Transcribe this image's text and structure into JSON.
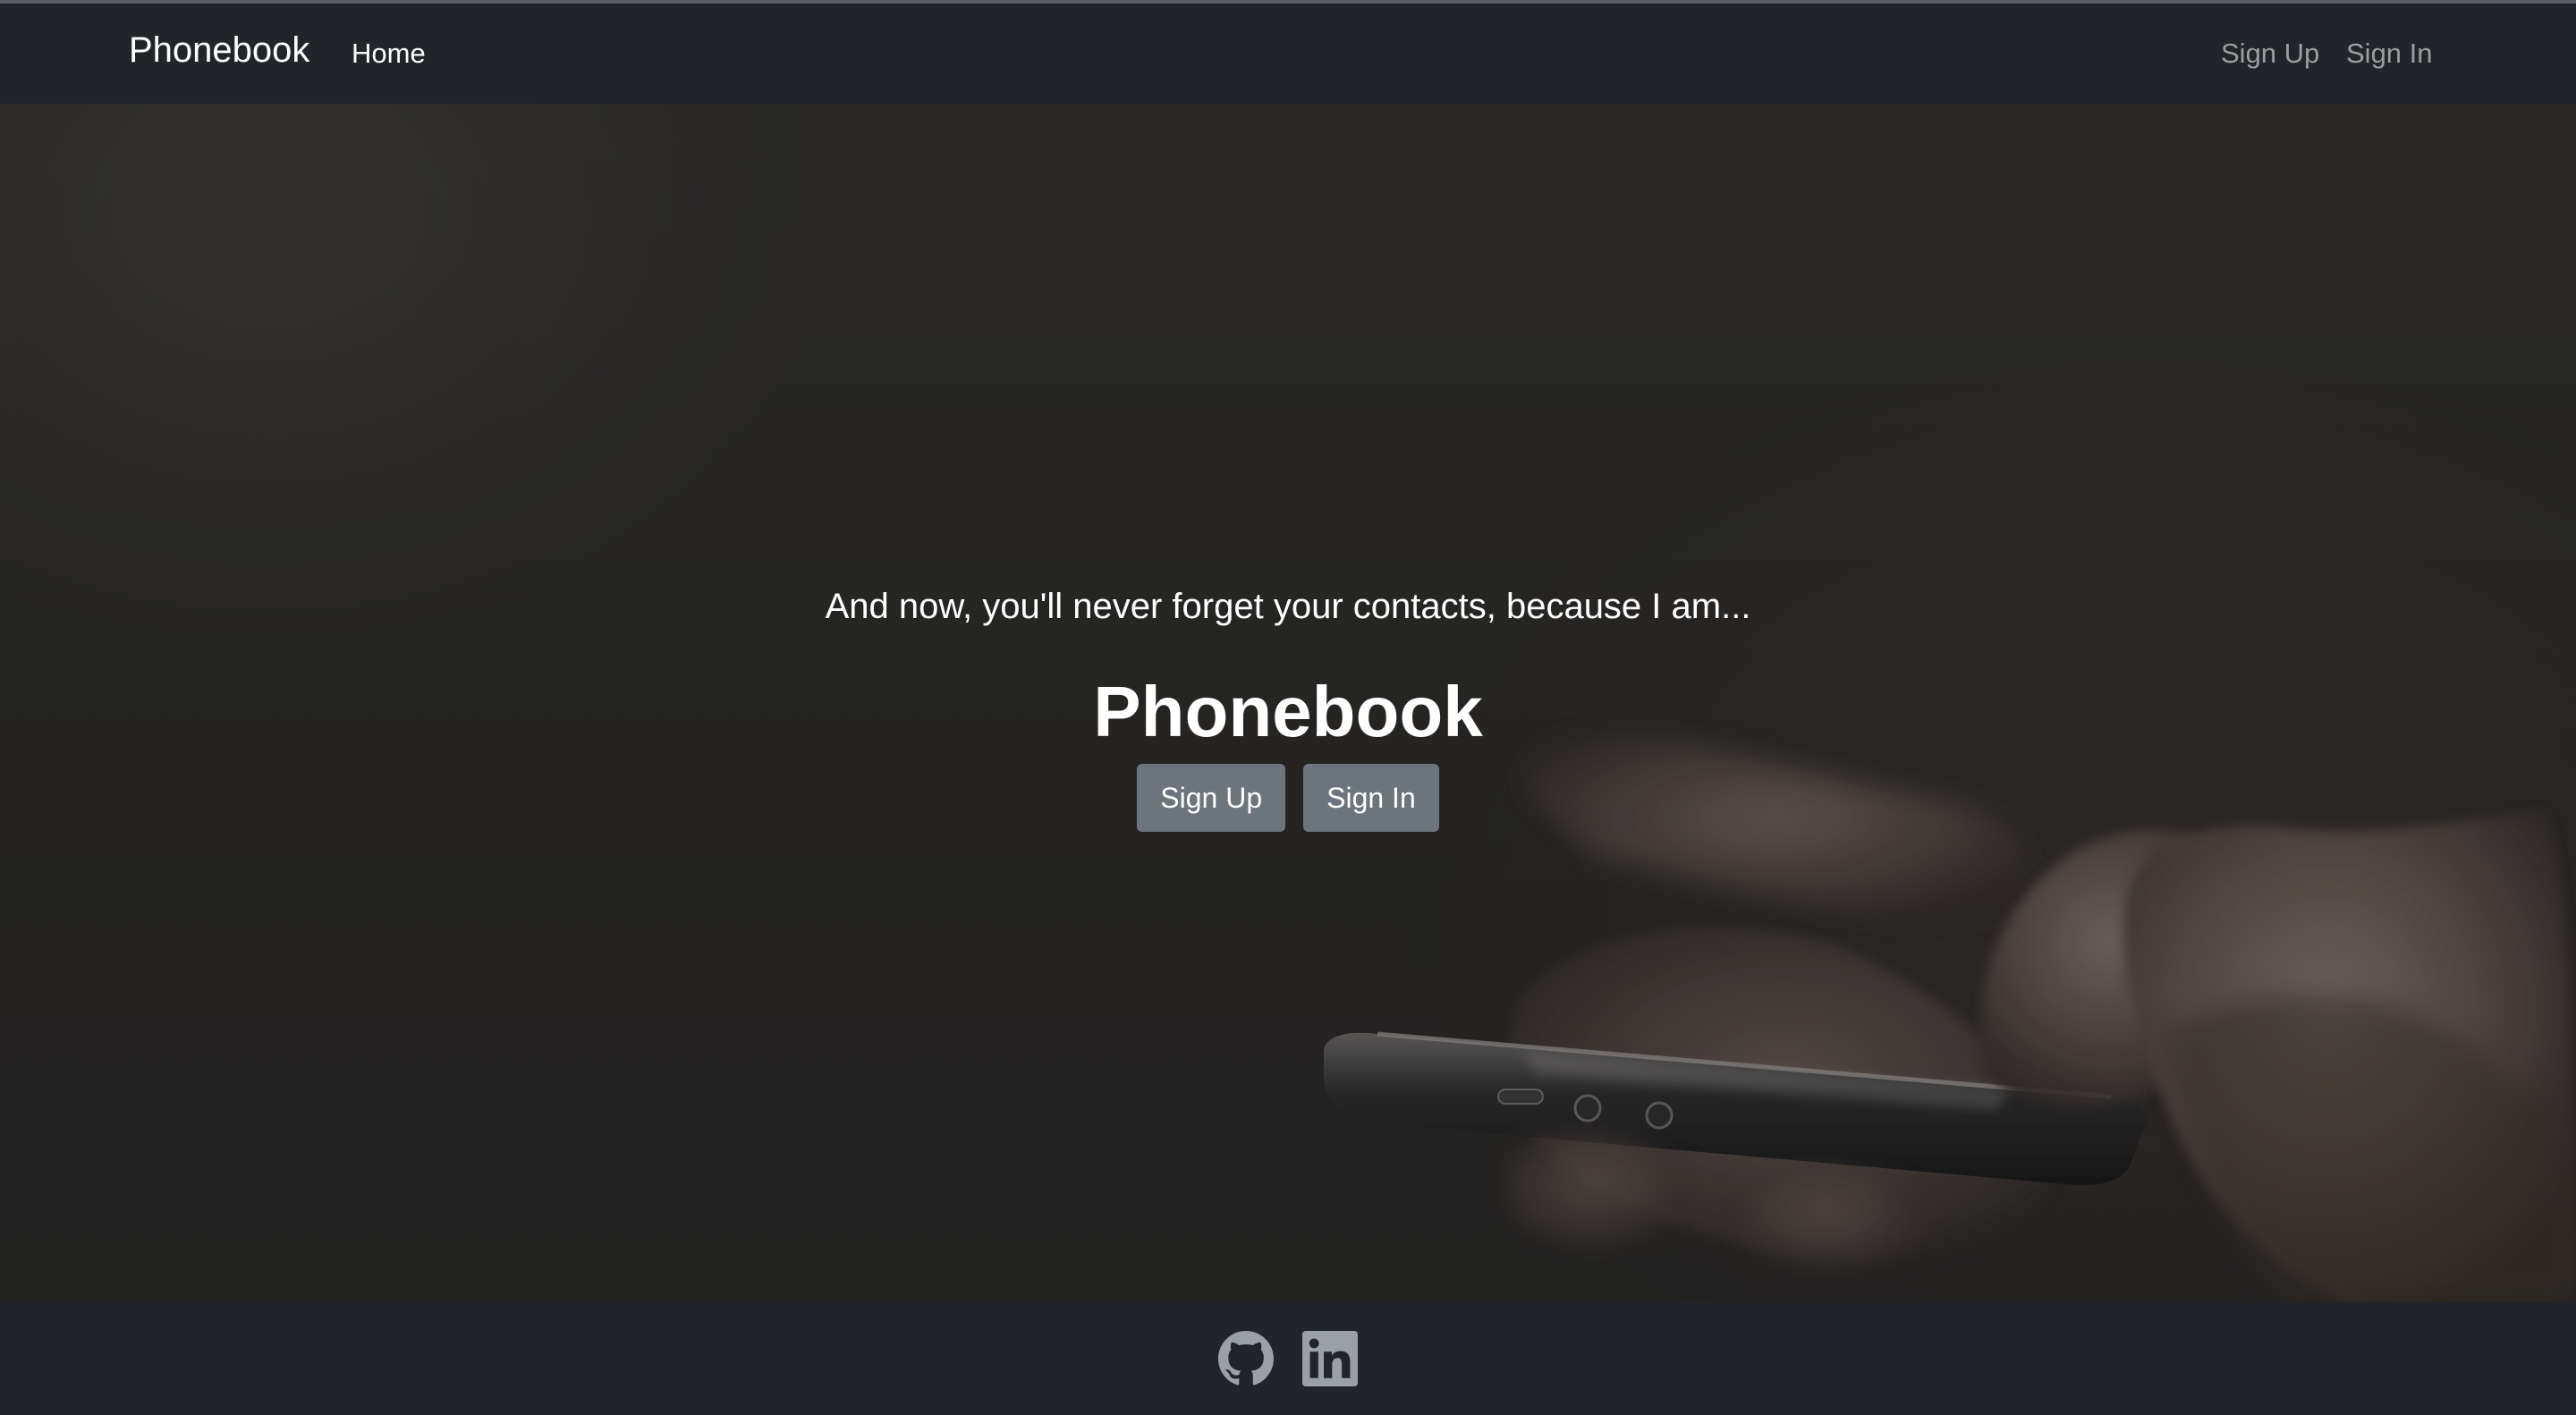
{
  "navbar": {
    "brand": "Phonebook",
    "links": {
      "home": "Home",
      "sign_up": "Sign Up",
      "sign_in": "Sign In"
    }
  },
  "hero": {
    "tagline": "And now, you'll never forget your contacts, because I am...",
    "title": "Phonebook",
    "buttons": {
      "sign_up": "Sign Up",
      "sign_in": "Sign In"
    },
    "background_image": "hands-holding-smartphone-photo"
  },
  "footer": {
    "icons": [
      "github-icon",
      "linkedin-icon"
    ]
  },
  "colors": {
    "navbar_bg": "#212529",
    "button_bg": "#6c757d",
    "nav_muted_text": "rgba(255,255,255,0.55)",
    "footer_icon": "#9aa0a6"
  }
}
